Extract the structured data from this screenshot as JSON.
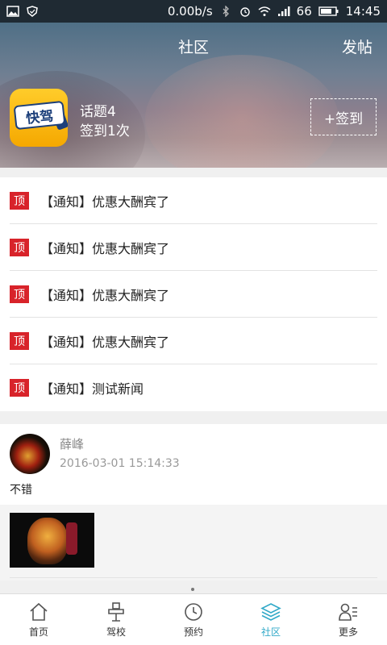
{
  "status_bar": {
    "net_speed": "0.00b/s",
    "battery": "66",
    "time": "14:45"
  },
  "header": {
    "title": "社区",
    "post_label": "发帖"
  },
  "profile": {
    "logo_text": "快驾",
    "topic_count": "话题4",
    "checkin_count": "签到1次",
    "checkin_button": "+签到"
  },
  "notices": [
    {
      "badge": "顶",
      "text": "【通知】优惠大酬宾了"
    },
    {
      "badge": "顶",
      "text": "【通知】优惠大酬宾了"
    },
    {
      "badge": "顶",
      "text": "【通知】优惠大酬宾了"
    },
    {
      "badge": "顶",
      "text": "【通知】优惠大酬宾了"
    },
    {
      "badge": "顶",
      "text": "【通知】测试新闻"
    }
  ],
  "post": {
    "author": "薛峰",
    "time": "2016-03-01 15:14:33",
    "text": "不错"
  },
  "tabs": [
    {
      "label": "首页",
      "icon": "home-icon"
    },
    {
      "label": "驾校",
      "icon": "school-icon"
    },
    {
      "label": "预约",
      "icon": "clock-icon"
    },
    {
      "label": "社区",
      "icon": "layers-icon",
      "active": true
    },
    {
      "label": "更多",
      "icon": "person-list-icon"
    }
  ],
  "colors": {
    "accent": "#31a9c8",
    "top_badge": "#d8232a"
  }
}
